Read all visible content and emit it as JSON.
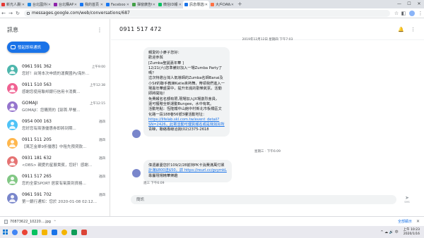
{
  "browser": {
    "tabs": [
      {
        "label": "新光人壽投保 ...",
        "color": "#e53935",
        "active": false
      },
      {
        "label": "台北國外觀光 ...",
        "color": "#1e88e5",
        "active": false
      },
      {
        "label": "台北購APP上 ...",
        "color": "#8e24aa",
        "active": false
      },
      {
        "label": "我的首頁 - Fa ...",
        "color": "#1877f2",
        "active": false
      },
      {
        "label": "Facebook",
        "color": "#1877f2",
        "active": false
      },
      {
        "label": "彈窗廣告008 ...",
        "color": "#43a047",
        "active": false
      },
      {
        "label": "微信ID報名 ...",
        "color": "#07c160",
        "active": false
      },
      {
        "label": "訊息傳送的 ...",
        "color": "#1a73e8",
        "active": true
      },
      {
        "label": "大戶DAWHO ...",
        "color": "#ff7043",
        "active": false
      }
    ],
    "new_tab": "+",
    "url": "messages.google.com/web/conversations/687"
  },
  "sidebar": {
    "title": "訊息",
    "start_chat_label": "發起即時通訊",
    "conversations": [
      {
        "name": "0961 591 362",
        "snippet": "您好！台灣本次申請的運費國內/海外...",
        "time": "上午9:00",
        "color": "#4db6ac"
      },
      {
        "name": "0911 510 563",
        "snippet": "感謝您使用聯邦銀行信用卡消費...",
        "time": "上午12:38",
        "color": "#f06292"
      },
      {
        "name": "GOMAJI",
        "snippet": "GOMAJI：您購買的【部首.早餐...",
        "time": "上午12:15",
        "color": "#9575cd"
      },
      {
        "name": "0954 000 163",
        "snippet": "您好您有兩張優惠券即將到期...",
        "time": "週四",
        "color": "#4fc3f7"
      },
      {
        "name": "0911 511 205",
        "snippet": "【萬芝金單9折優惠】中租先預貸款...",
        "time": "週四",
        "color": "#ffb74d"
      },
      {
        "name": "0931 181 632",
        "snippet": "<DBS> 親愛的星展貴賓，您好！感謝...",
        "time": "週四",
        "color": "#e57373"
      },
      {
        "name": "0911 517 265",
        "snippet": "您的全家SPORT 居家有氧簽到資格...",
        "time": "週四",
        "color": "#81c784"
      },
      {
        "name": "0961 591 702",
        "snippet": "第一銀行通知：您於 2020-01-08 02:12...",
        "time": "週四",
        "color": "#7986cb"
      }
    ]
  },
  "main": {
    "title": "0911 517 472",
    "day_stamp_1": "2019年12月12日 星期四 下午7:03",
    "message_1_lines": [
      "親愛的小麥子您好：",
      "歡迎參與",
      "[Zumba聖誕嘉年華 ]",
      "12/21(六)您準備好加入一場Zumba Party了",
      "嗎？",
      "這次特邀台灣人氣導師的Zumba名師Banai及",
      "小Sif的聯手教練Katie來熱舞，帶領我們進入一",
      "場嘉年華盛宴中，提升年底的歡樂氣氛，活動",
      "即將開始！",
      "免費報名名額有限,現場加入JX場激烈會員，",
      "還可獲贈全新運動Bungee，水中有氧。",
      "活動地點：恆隆鐵中山館中村新北市板橋區文",
      "化路一段188巷56號3樓活動地址：",
      "https://lifelab.skl.com.tw/event_detail?",
      "SN=2426，此寄活動可優質報名或是我如好所",
      "青睞，聯絡專線洽詢(02)2375-2618"
    ],
    "message_1_link_indices": [
      13,
      14
    ],
    "day_stamp_2": "星期三 · 下午6:09",
    "message_2_lines": [
      "偉週叢憂您於109/2/28前持PK卡消費滿萬付累",
      "計滿$800送$50，詳 https://reurl.cc/gvymkL",
      "專屬現場精華樂趣"
    ],
    "message_2_link_indices": [
      1
    ],
    "message_2_time": "週三 下午6:09",
    "composer_placeholder": "簡訊",
    "send_label": "SMS"
  },
  "downloads": {
    "file": "70873622_10220....jpg",
    "show_all": "全部顯示"
  },
  "taskbar": {
    "apps": [
      {
        "color": "#4285f4",
        "round": true
      },
      {
        "color": "#ea4335",
        "round": true
      },
      {
        "color": "#07c160",
        "round": false
      },
      {
        "color": "#f4b400",
        "round": false
      },
      {
        "color": "#1a73e8",
        "round": false
      },
      {
        "color": "#f4b400",
        "round": true
      },
      {
        "color": "#0f9d58",
        "round": false
      },
      {
        "color": "#db4437",
        "round": false
      }
    ],
    "tray_text": "^ ☁ 🔊 中",
    "time": "上午 10:23",
    "date": "2020/1/16"
  },
  "colors": {
    "accent": "#1a73e8",
    "bubble": "#f1f3f4"
  }
}
